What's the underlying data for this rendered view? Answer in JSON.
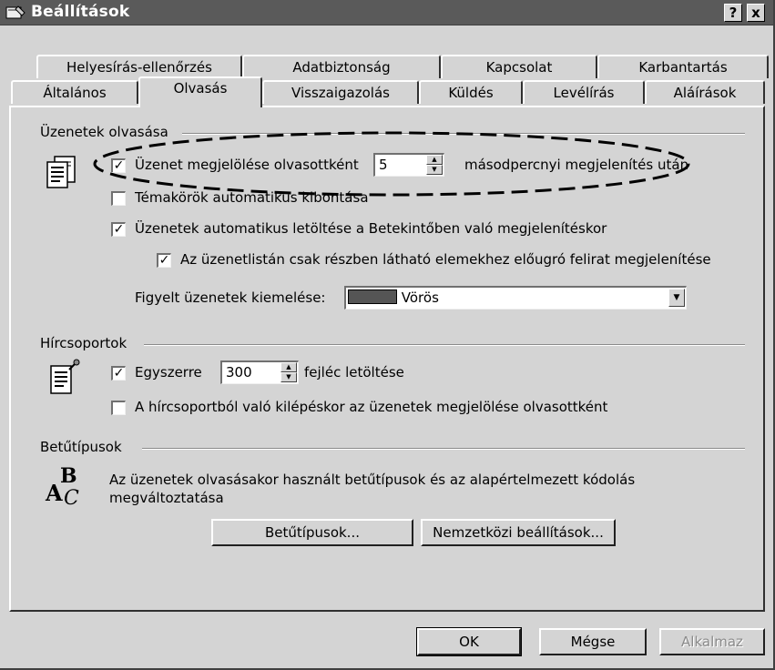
{
  "window": {
    "title": "Beállítások",
    "help_button": "?",
    "close_button": "x"
  },
  "tabs_row1": [
    "Helyesírás-ellenőrzés",
    "Adatbiztonság",
    "Kapcsolat",
    "Karbantartás"
  ],
  "tabs_row2": [
    "Általános",
    "Olvasás",
    "Visszaigazolás",
    "Küldés",
    "Levélírás",
    "Aláírások"
  ],
  "active_tab": "Olvasás",
  "reading": {
    "group_title": "Üzenetek olvasása",
    "mark_read": {
      "checked": true,
      "label": "Üzenet megjelölése olvasottként",
      "value": "5",
      "suffix": "másodpercnyi megjelenítés után"
    },
    "expand_threads": {
      "checked": false,
      "label": "Témakörök automatikus kibontása"
    },
    "auto_download": {
      "checked": true,
      "label": "Üzenetek automatikus letöltése a Betekintőben való megjelenítéskor"
    },
    "tooltips": {
      "checked": true,
      "label": "Az üzenetlistán csak részben látható elemekhez előugró felirat megjelenítése"
    },
    "highlight_label": "Figyelt üzenetek kiemelése:",
    "highlight_value": "Vörös",
    "highlight_color": "#555555"
  },
  "news": {
    "group_title": "Hírcsoportok",
    "headers": {
      "checked": true,
      "label_before": "Egyszerre",
      "value": "300",
      "label_after": "fejléc letöltése"
    },
    "mark_on_exit": {
      "checked": false,
      "label": "A hírcsoportból való kilépéskor az üzenetek megjelölése olvasottként"
    }
  },
  "fonts": {
    "group_title": "Betűtípusok",
    "description_line1": "Az üzenetek olvasásakor használt betűtípusok és az alapértelmezett kódolás",
    "description_line2": "megváltoztatása",
    "fonts_button": "Betűtípusok...",
    "intl_button": "Nemzetközi beállítások..."
  },
  "footer": {
    "ok": "OK",
    "cancel": "Mégse",
    "apply": "Alkalmaz"
  },
  "icons": {
    "title": "settings-window-icon",
    "reading": "document-icon",
    "news": "pinned-note-icon",
    "fonts": "font-letters-icon"
  }
}
